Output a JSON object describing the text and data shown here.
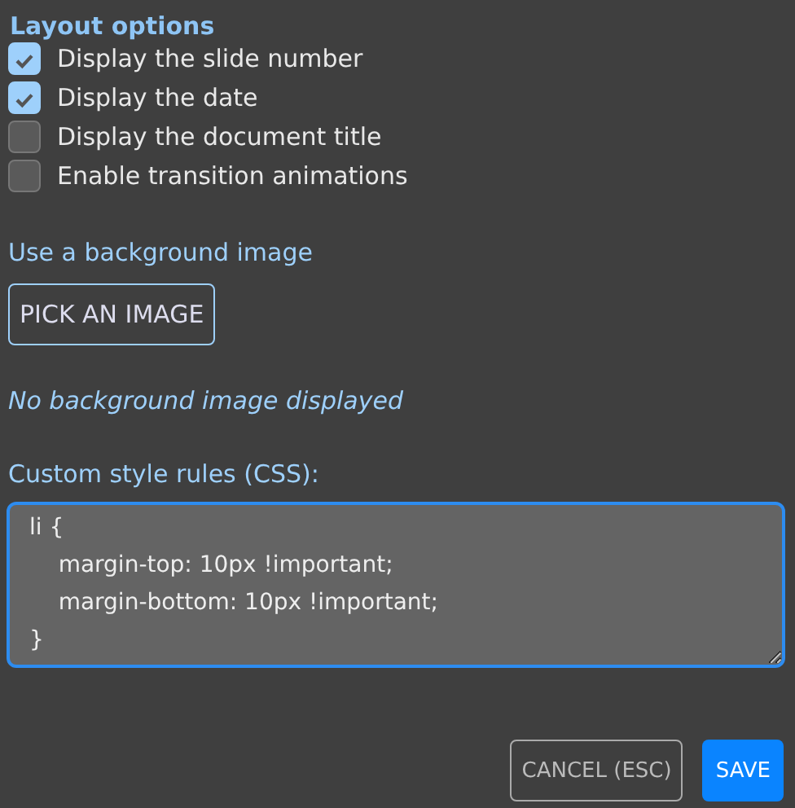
{
  "section_title": "Layout options",
  "options": [
    {
      "label": "Display the slide number",
      "checked": true
    },
    {
      "label": "Display the date",
      "checked": true
    },
    {
      "label": "Display the document title",
      "checked": false
    },
    {
      "label": "Enable transition animations",
      "checked": false
    }
  ],
  "background": {
    "label": "Use a background image",
    "button": "PICK AN IMAGE",
    "status": "No background image displayed"
  },
  "css": {
    "label": "Custom style rules (CSS):",
    "value": "li {\n    margin-top: 10px !important;\n    margin-bottom: 10px !important;\n}"
  },
  "buttons": {
    "cancel": "CANCEL (ESC)",
    "save": "SAVE"
  }
}
